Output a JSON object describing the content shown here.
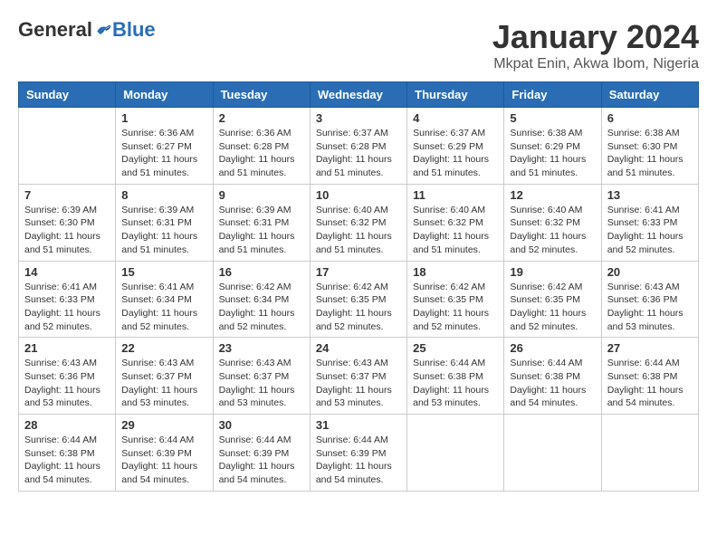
{
  "header": {
    "logo_general": "General",
    "logo_blue": "Blue",
    "month": "January 2024",
    "location": "Mkpat Enin, Akwa Ibom, Nigeria"
  },
  "days_of_week": [
    "Sunday",
    "Monday",
    "Tuesday",
    "Wednesday",
    "Thursday",
    "Friday",
    "Saturday"
  ],
  "weeks": [
    [
      {
        "day": "",
        "sunrise": "",
        "sunset": "",
        "daylight": ""
      },
      {
        "day": "1",
        "sunrise": "Sunrise: 6:36 AM",
        "sunset": "Sunset: 6:27 PM",
        "daylight": "Daylight: 11 hours and 51 minutes."
      },
      {
        "day": "2",
        "sunrise": "Sunrise: 6:36 AM",
        "sunset": "Sunset: 6:28 PM",
        "daylight": "Daylight: 11 hours and 51 minutes."
      },
      {
        "day": "3",
        "sunrise": "Sunrise: 6:37 AM",
        "sunset": "Sunset: 6:28 PM",
        "daylight": "Daylight: 11 hours and 51 minutes."
      },
      {
        "day": "4",
        "sunrise": "Sunrise: 6:37 AM",
        "sunset": "Sunset: 6:29 PM",
        "daylight": "Daylight: 11 hours and 51 minutes."
      },
      {
        "day": "5",
        "sunrise": "Sunrise: 6:38 AM",
        "sunset": "Sunset: 6:29 PM",
        "daylight": "Daylight: 11 hours and 51 minutes."
      },
      {
        "day": "6",
        "sunrise": "Sunrise: 6:38 AM",
        "sunset": "Sunset: 6:30 PM",
        "daylight": "Daylight: 11 hours and 51 minutes."
      }
    ],
    [
      {
        "day": "7",
        "sunrise": "Sunrise: 6:39 AM",
        "sunset": "Sunset: 6:30 PM",
        "daylight": "Daylight: 11 hours and 51 minutes."
      },
      {
        "day": "8",
        "sunrise": "Sunrise: 6:39 AM",
        "sunset": "Sunset: 6:31 PM",
        "daylight": "Daylight: 11 hours and 51 minutes."
      },
      {
        "day": "9",
        "sunrise": "Sunrise: 6:39 AM",
        "sunset": "Sunset: 6:31 PM",
        "daylight": "Daylight: 11 hours and 51 minutes."
      },
      {
        "day": "10",
        "sunrise": "Sunrise: 6:40 AM",
        "sunset": "Sunset: 6:32 PM",
        "daylight": "Daylight: 11 hours and 51 minutes."
      },
      {
        "day": "11",
        "sunrise": "Sunrise: 6:40 AM",
        "sunset": "Sunset: 6:32 PM",
        "daylight": "Daylight: 11 hours and 51 minutes."
      },
      {
        "day": "12",
        "sunrise": "Sunrise: 6:40 AM",
        "sunset": "Sunset: 6:32 PM",
        "daylight": "Daylight: 11 hours and 52 minutes."
      },
      {
        "day": "13",
        "sunrise": "Sunrise: 6:41 AM",
        "sunset": "Sunset: 6:33 PM",
        "daylight": "Daylight: 11 hours and 52 minutes."
      }
    ],
    [
      {
        "day": "14",
        "sunrise": "Sunrise: 6:41 AM",
        "sunset": "Sunset: 6:33 PM",
        "daylight": "Daylight: 11 hours and 52 minutes."
      },
      {
        "day": "15",
        "sunrise": "Sunrise: 6:41 AM",
        "sunset": "Sunset: 6:34 PM",
        "daylight": "Daylight: 11 hours and 52 minutes."
      },
      {
        "day": "16",
        "sunrise": "Sunrise: 6:42 AM",
        "sunset": "Sunset: 6:34 PM",
        "daylight": "Daylight: 11 hours and 52 minutes."
      },
      {
        "day": "17",
        "sunrise": "Sunrise: 6:42 AM",
        "sunset": "Sunset: 6:35 PM",
        "daylight": "Daylight: 11 hours and 52 minutes."
      },
      {
        "day": "18",
        "sunrise": "Sunrise: 6:42 AM",
        "sunset": "Sunset: 6:35 PM",
        "daylight": "Daylight: 11 hours and 52 minutes."
      },
      {
        "day": "19",
        "sunrise": "Sunrise: 6:42 AM",
        "sunset": "Sunset: 6:35 PM",
        "daylight": "Daylight: 11 hours and 52 minutes."
      },
      {
        "day": "20",
        "sunrise": "Sunrise: 6:43 AM",
        "sunset": "Sunset: 6:36 PM",
        "daylight": "Daylight: 11 hours and 53 minutes."
      }
    ],
    [
      {
        "day": "21",
        "sunrise": "Sunrise: 6:43 AM",
        "sunset": "Sunset: 6:36 PM",
        "daylight": "Daylight: 11 hours and 53 minutes."
      },
      {
        "day": "22",
        "sunrise": "Sunrise: 6:43 AM",
        "sunset": "Sunset: 6:37 PM",
        "daylight": "Daylight: 11 hours and 53 minutes."
      },
      {
        "day": "23",
        "sunrise": "Sunrise: 6:43 AM",
        "sunset": "Sunset: 6:37 PM",
        "daylight": "Daylight: 11 hours and 53 minutes."
      },
      {
        "day": "24",
        "sunrise": "Sunrise: 6:43 AM",
        "sunset": "Sunset: 6:37 PM",
        "daylight": "Daylight: 11 hours and 53 minutes."
      },
      {
        "day": "25",
        "sunrise": "Sunrise: 6:44 AM",
        "sunset": "Sunset: 6:38 PM",
        "daylight": "Daylight: 11 hours and 53 minutes."
      },
      {
        "day": "26",
        "sunrise": "Sunrise: 6:44 AM",
        "sunset": "Sunset: 6:38 PM",
        "daylight": "Daylight: 11 hours and 54 minutes."
      },
      {
        "day": "27",
        "sunrise": "Sunrise: 6:44 AM",
        "sunset": "Sunset: 6:38 PM",
        "daylight": "Daylight: 11 hours and 54 minutes."
      }
    ],
    [
      {
        "day": "28",
        "sunrise": "Sunrise: 6:44 AM",
        "sunset": "Sunset: 6:38 PM",
        "daylight": "Daylight: 11 hours and 54 minutes."
      },
      {
        "day": "29",
        "sunrise": "Sunrise: 6:44 AM",
        "sunset": "Sunset: 6:39 PM",
        "daylight": "Daylight: 11 hours and 54 minutes."
      },
      {
        "day": "30",
        "sunrise": "Sunrise: 6:44 AM",
        "sunset": "Sunset: 6:39 PM",
        "daylight": "Daylight: 11 hours and 54 minutes."
      },
      {
        "day": "31",
        "sunrise": "Sunrise: 6:44 AM",
        "sunset": "Sunset: 6:39 PM",
        "daylight": "Daylight: 11 hours and 54 minutes."
      },
      {
        "day": "",
        "sunrise": "",
        "sunset": "",
        "daylight": ""
      },
      {
        "day": "",
        "sunrise": "",
        "sunset": "",
        "daylight": ""
      },
      {
        "day": "",
        "sunrise": "",
        "sunset": "",
        "daylight": ""
      }
    ]
  ]
}
